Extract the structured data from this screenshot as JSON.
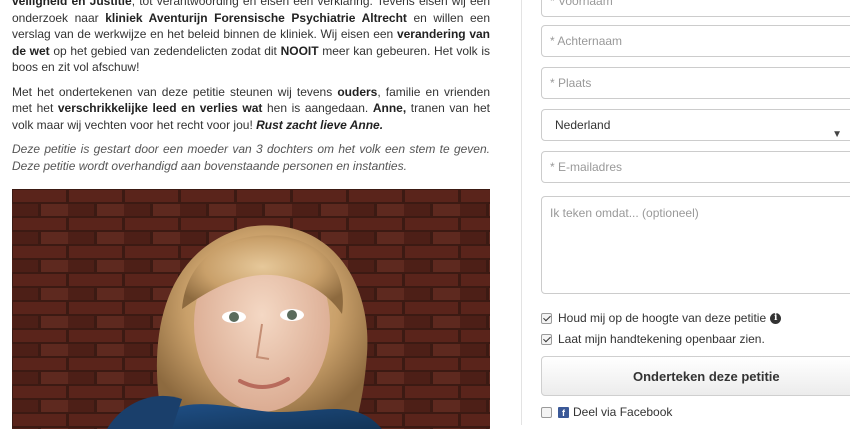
{
  "article": {
    "p1": {
      "s1": "veiligheid en Justitie",
      "s2": ", tot verantwoording en eisen een verklaring. Tevens eisen wij een onderzoek naar ",
      "s3": "kliniek Aventurijn Forensische Psychiatrie Altrecht",
      "s4": " en willen een verslag van de werkwijze en het beleid binnen de kliniek. Wij eisen een ",
      "s5": "verandering van de wet",
      "s6": " op het gebied van zedendelicten zodat dit ",
      "s7": "NOOIT",
      "s8": " meer kan gebeuren. Het volk is boos en zit vol afschuw!"
    },
    "p2": {
      "s1": "Met het ondertekenen van deze petitie steunen wij tevens ",
      "s2": "ouders",
      "s3": ", familie en vrienden met het ",
      "s4": "verschrikkelijke leed en verlies wat",
      "s5": " hen is aangedaan. ",
      "s6": "Anne,",
      "s7": " tranen van het volk maar wij vechten voor het recht voor jou! ",
      "s8": "Rust zacht lieve Anne."
    },
    "p3": "Deze petitie is gestart door een moeder van 3 dochters om het volk een stem te geven. Deze petitie wordt overhandigd aan bovenstaande personen en instanties."
  },
  "form": {
    "firstname_placeholder": "* Voornaam",
    "lastname_placeholder": "* Achternaam",
    "city_placeholder": "* Plaats",
    "country_value": "Nederland",
    "email_placeholder": "* E-mailadres",
    "comment_placeholder": "Ik teken omdat... (optioneel)",
    "keep_updated_label": "Houd mij op de hoogte van deze petitie",
    "public_signature_label": "Laat mijn handtekening openbaar zien.",
    "sign_button_label": "Onderteken deze petitie",
    "facebook_share_label": "Deel via Facebook"
  }
}
